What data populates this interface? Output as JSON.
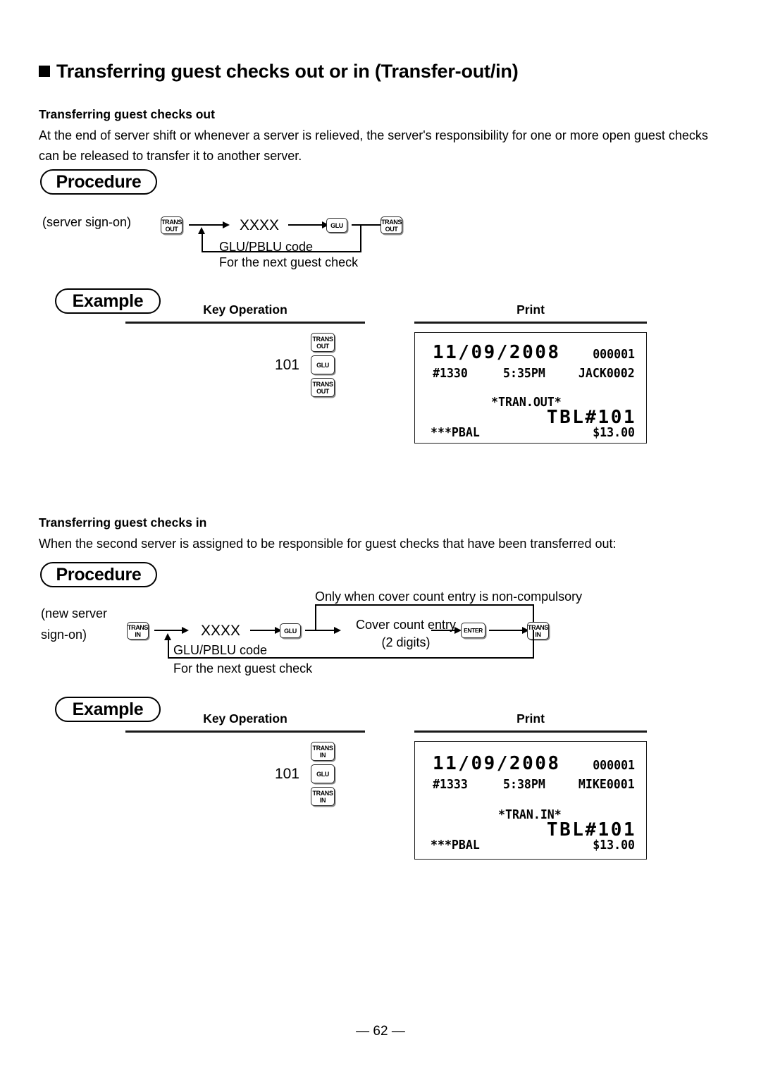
{
  "page": {
    "number_label": "— 62 —"
  },
  "title": "Transferring guest checks out or in (Transfer-out/in)",
  "section_out": {
    "heading": "Transferring guest checks out",
    "body": "At the end of server shift or whenever a server is relieved, the server's responsibility for one or more open guest checks can be released to transfer it to another server.",
    "procedure_label": "Procedure",
    "example_label": "Example",
    "diagram": {
      "prefix": "(server sign-on)",
      "key1": {
        "line1": "TRANS",
        "line2": "OUT"
      },
      "code": "XXXX",
      "code_caption": "GLU/PBLU code",
      "key2": {
        "line1": "GLU",
        "line2": ""
      },
      "key3": {
        "line1": "TRANS",
        "line2": "OUT"
      },
      "loop_caption": "For the next guest check"
    },
    "columns": {
      "key_operation": "Key Operation",
      "print": "Print"
    },
    "key_operation": {
      "amount": "101",
      "keys": [
        {
          "line1": "TRANS",
          "line2": "OUT"
        },
        {
          "line1": "GLU",
          "line2": ""
        },
        {
          "line1": "TRANS",
          "line2": "OUT"
        }
      ]
    },
    "receipt": {
      "date": "11/09/2008",
      "counter": "000001",
      "register": "#1330",
      "time": "5:35PM",
      "clerk": "JACK0002",
      "mode": "*TRAN.OUT*",
      "table": "TBL#101",
      "balance_label": "***PBAL",
      "balance_value": "$13.00"
    }
  },
  "section_in": {
    "heading": "Transferring guest checks in",
    "body": "When the second server is assigned to be responsible for guest checks that have been transferred out:",
    "procedure_label": "Procedure",
    "example_label": "Example",
    "diagram": {
      "prefix_line1": "(new server",
      "prefix_line2": "sign-on)",
      "bypass_caption": "Only when cover count entry is non-compulsory",
      "key1": {
        "line1": "TRANS",
        "line2": "IN"
      },
      "code": "XXXX",
      "code_caption": "GLU/PBLU code",
      "key2": {
        "line1": "GLU",
        "line2": ""
      },
      "cover_line1": "Cover count entry",
      "cover_line2": "(2 digits)",
      "key3": {
        "line1": "ENTER",
        "line2": ""
      },
      "key4": {
        "line1": "TRANS",
        "line2": "IN"
      },
      "loop_caption": "For the next guest check"
    },
    "columns": {
      "key_operation": "Key Operation",
      "print": "Print"
    },
    "key_operation": {
      "amount": "101",
      "keys": [
        {
          "line1": "TRANS",
          "line2": "IN"
        },
        {
          "line1": "GLU",
          "line2": ""
        },
        {
          "line1": "TRANS",
          "line2": "IN"
        }
      ]
    },
    "receipt": {
      "date": "11/09/2008",
      "counter": "000001",
      "register": "#1333",
      "time": "5:38PM",
      "clerk": "MIKE0001",
      "mode": "*TRAN.IN*",
      "table": "TBL#101",
      "balance_label": "***PBAL",
      "balance_value": "$13.00"
    }
  }
}
